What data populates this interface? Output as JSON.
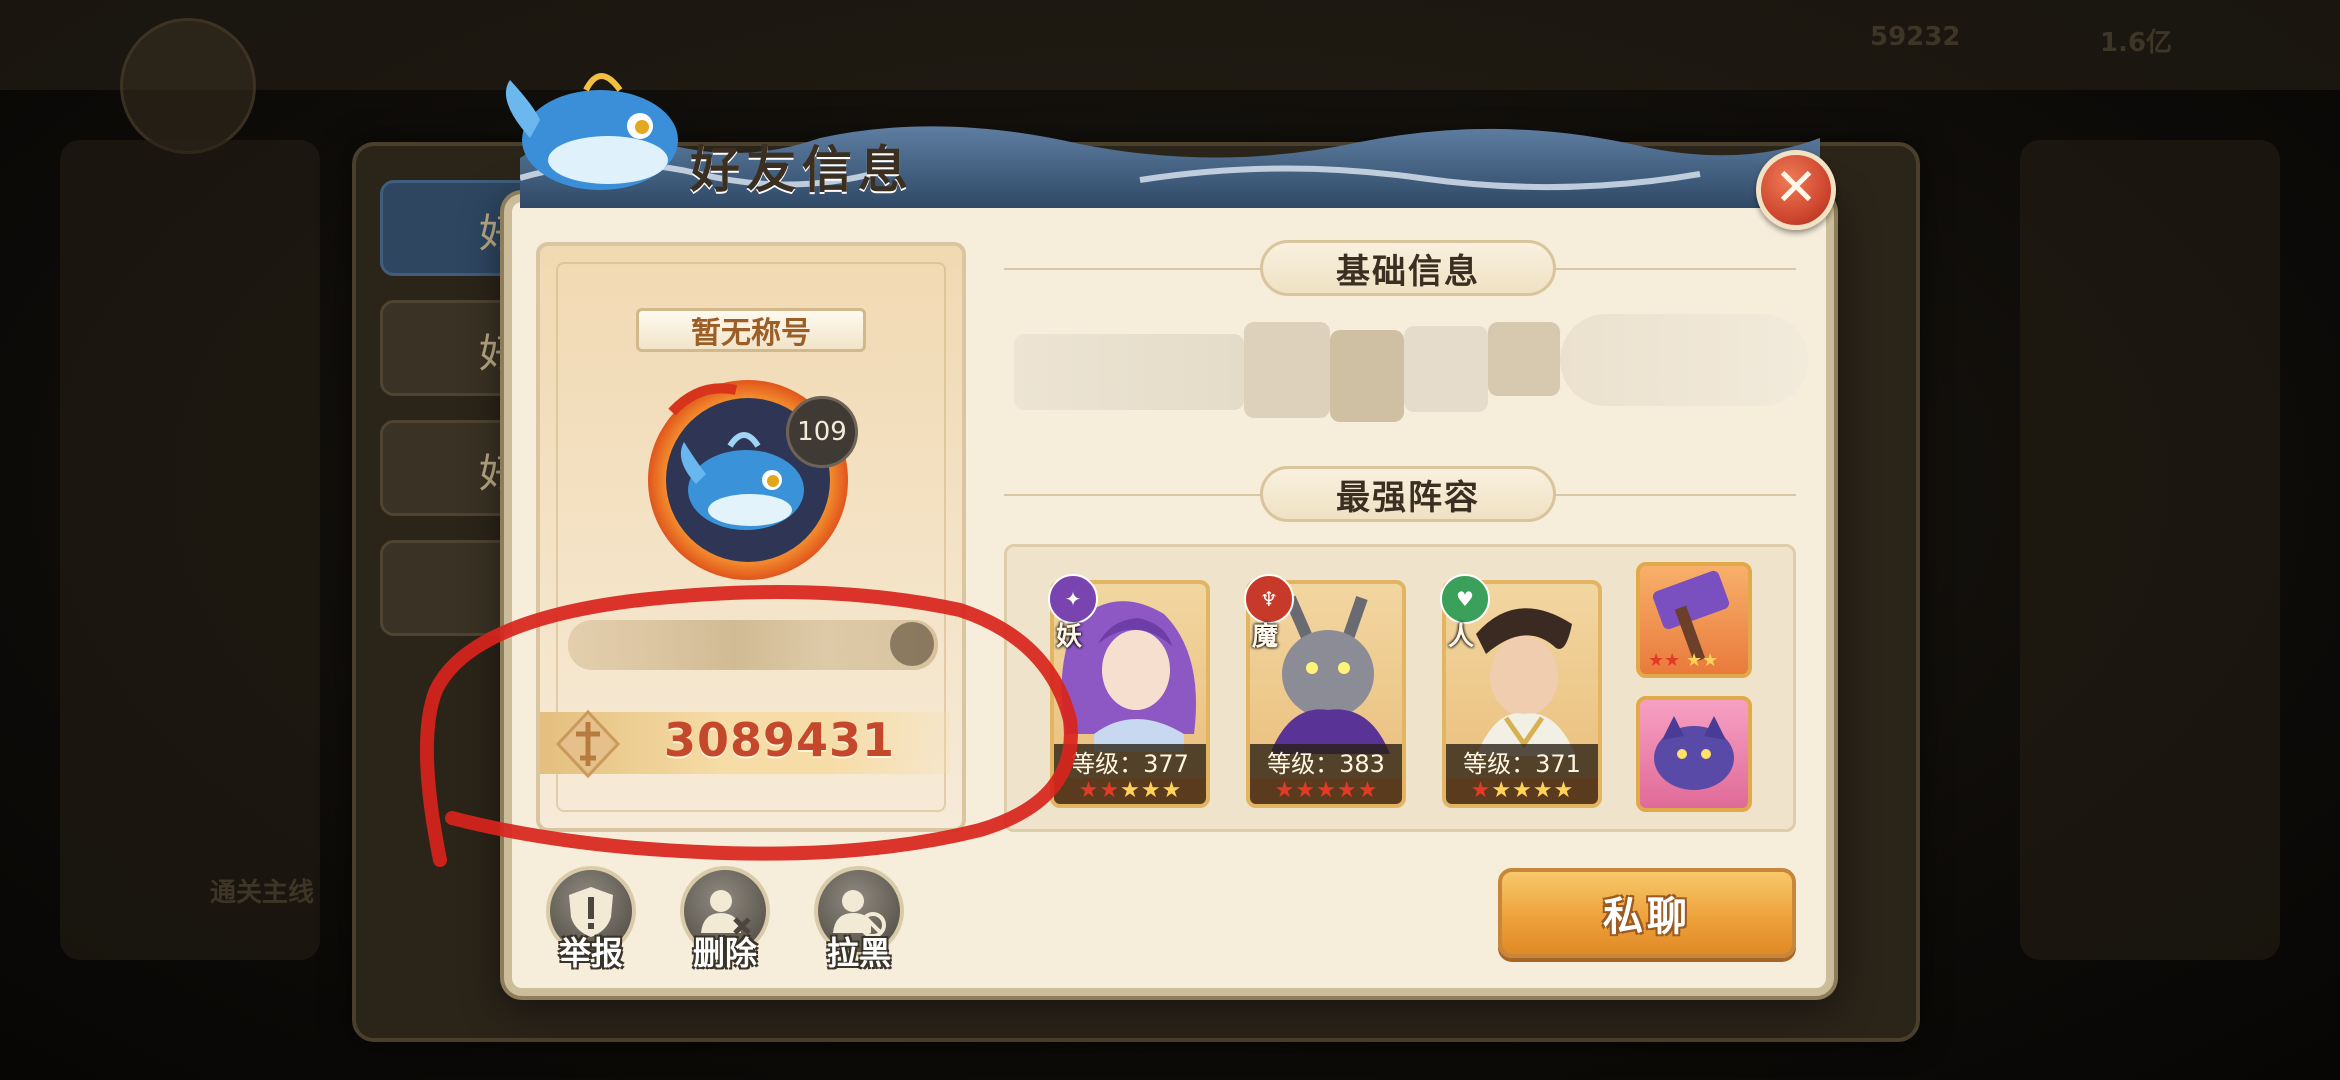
{
  "background": {
    "top_value_1": "59232",
    "top_value_2": "1.6亿",
    "side_text": "通关主线"
  },
  "dialog": {
    "title": "好友信息",
    "close_icon": "close-icon"
  },
  "profile": {
    "title_plate": "暂无称号",
    "level": "109",
    "power": "3089431",
    "power_icon": "power-sword-icon"
  },
  "sections": {
    "basic_info": "基础信息",
    "strongest_lineup": "最强阵容"
  },
  "lineup": {
    "heroes": [
      {
        "faction": "妖",
        "level_text": "等级：377",
        "stars_red": 2,
        "stars_gold": 3
      },
      {
        "faction": "魔",
        "level_text": "等级：383",
        "stars_red": 5,
        "stars_gold": 0
      },
      {
        "faction": "人",
        "level_text": "等级：371",
        "stars_red": 1,
        "stars_gold": 4
      }
    ],
    "items": [
      {
        "name": "hammer-artifact-icon",
        "stars_red": 2,
        "stars_gold": 2
      },
      {
        "name": "dragon-pet-icon"
      }
    ]
  },
  "actions": {
    "report": "举报",
    "delete": "删除",
    "block": "拉黑",
    "private_chat": "私聊"
  },
  "colors": {
    "power_text": "#c4492c",
    "chat_button": "#eea23c",
    "dialog_bg": "#f6eddb",
    "annotation": "#d8241c"
  }
}
